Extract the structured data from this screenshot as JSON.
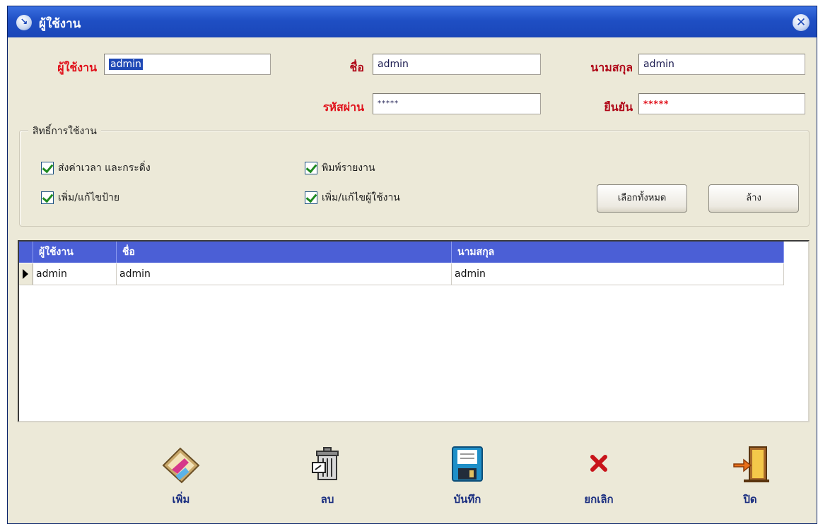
{
  "window": {
    "title": "ผู้ใช้งาน",
    "close_glyph": "✕"
  },
  "form": {
    "username_label": "ผู้ใช้งาน",
    "username_value": "admin",
    "firstname_label": "ชื่อ",
    "firstname_value": "admin",
    "lastname_label": "นามสกุล",
    "lastname_value": "admin",
    "password_label": "รหัสผ่าน",
    "password_value": "*****",
    "confirm_label": "ยืนยัน",
    "confirm_value": "*****"
  },
  "permissions": {
    "title": "สิทธิ์การใช้งาน",
    "items": [
      {
        "label": "ส่งค่าเวลา และกระดิ่ง",
        "checked": true
      },
      {
        "label": "พิมพ์รายงาน",
        "checked": true
      },
      {
        "label": "เพิ่ม/แก้ไขป้าย",
        "checked": true
      },
      {
        "label": "เพิ่ม/แก้ไขผู้ใช้งาน",
        "checked": true
      }
    ],
    "select_all_label": "เลือกทั้งหมด",
    "clear_label": "ล้าง"
  },
  "table": {
    "columns": [
      "ผู้ใช้งาน",
      "ชื่อ",
      "นามสกุล"
    ],
    "rows": [
      [
        "admin",
        "admin",
        "admin"
      ]
    ]
  },
  "toolbar": {
    "add_label": "เพิ่ม",
    "delete_label": "ลบ",
    "save_label": "บันทึก",
    "cancel_label": "ยกเลิก",
    "close_label": "ปิด"
  },
  "colors": {
    "title_bar": "#1f4fc4",
    "label_red": "#e0101a",
    "grid_header": "#4b5fd6",
    "toolbar_text": "#1a2e80"
  },
  "icons": [
    "app-icon",
    "close-icon",
    "add-icon",
    "delete-icon",
    "save-icon",
    "cancel-icon",
    "exit-icon"
  ]
}
